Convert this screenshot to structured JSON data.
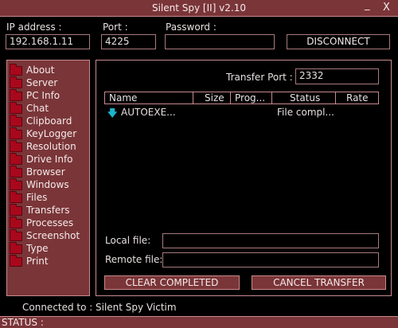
{
  "window": {
    "title": "Silent Spy [II] v2.10",
    "minimize": "_",
    "close": "X"
  },
  "connection": {
    "ip_label": "IP address :",
    "ip_value": "192.168.1.11",
    "port_label": "Port :",
    "port_value": "4225",
    "password_label": "Password :",
    "password_value": "",
    "disconnect_label": "DISCONNECT"
  },
  "sidebar": {
    "items": [
      {
        "label": "About"
      },
      {
        "label": "Server"
      },
      {
        "label": "PC Info"
      },
      {
        "label": "Chat"
      },
      {
        "label": "Clipboard"
      },
      {
        "label": "KeyLogger"
      },
      {
        "label": "Resolution"
      },
      {
        "label": "Drive Info"
      },
      {
        "label": "Browser"
      },
      {
        "label": "Windows"
      },
      {
        "label": "Files"
      },
      {
        "label": "Transfers"
      },
      {
        "label": "Processes"
      },
      {
        "label": "Screenshot"
      },
      {
        "label": "Type"
      },
      {
        "label": "Print"
      }
    ]
  },
  "transfers": {
    "transfer_port_label": "Transfer Port :",
    "transfer_port_value": "2332",
    "columns": [
      "Name",
      "Size",
      "Prog...",
      "Status",
      "Rate"
    ],
    "rows": [
      {
        "name": "AUTOEXE...",
        "size": "",
        "progress": "",
        "status": "File compl...",
        "rate": ""
      }
    ],
    "local_file_label": "Local file:",
    "local_file_value": "",
    "remote_file_label": "Remote file:",
    "remote_file_value": "",
    "clear_label": "CLEAR COMPLETED",
    "cancel_label": "CANCEL TRANSFER"
  },
  "footer": {
    "connected_label": "Connected to :",
    "connected_value": "Silent Spy Victim",
    "status_label": "STATUS :"
  },
  "colors": {
    "accent": "#7a3538",
    "border": "#c98a8d",
    "folder": "#a8081c",
    "download_arrow": "#1bb5c8"
  }
}
